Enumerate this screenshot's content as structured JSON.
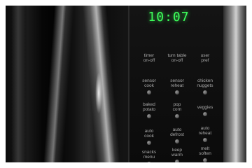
{
  "display": {
    "time": "10:07",
    "color": "#3cff5a"
  },
  "panel": {
    "rows": [
      [
        {
          "id": "timer",
          "label": "timer\non-off"
        },
        {
          "id": "turntable",
          "label": "turn table\non-off"
        },
        {
          "id": "user-pref",
          "label": "user\npref"
        }
      ],
      [
        {
          "id": "sensor-cook",
          "label": "sensor\ncook"
        },
        {
          "id": "sensor-reheat",
          "label": "sensor\nreheat"
        },
        {
          "id": "chicken-nuggets",
          "label": "chicken\nnuggets"
        }
      ],
      [
        {
          "id": "baked-potato",
          "label": "baked\npotato"
        },
        {
          "id": "pop-corn",
          "label": "pop\ncorn"
        },
        {
          "id": "veggies",
          "label": "veggies"
        }
      ],
      [
        {
          "id": "auto-cook",
          "label": "auto\ncook"
        },
        {
          "id": "auto-defrost",
          "label": "auto\ndefrost"
        },
        {
          "id": "auto-reheat",
          "label": "auto\nreheat"
        }
      ],
      [
        {
          "id": "snacks-menu",
          "label": "snacks\nmenu"
        },
        {
          "id": "keep-warm",
          "label": "keep\nwarm"
        },
        {
          "id": "melt-soften",
          "label": "melt\nsoften"
        }
      ]
    ]
  }
}
